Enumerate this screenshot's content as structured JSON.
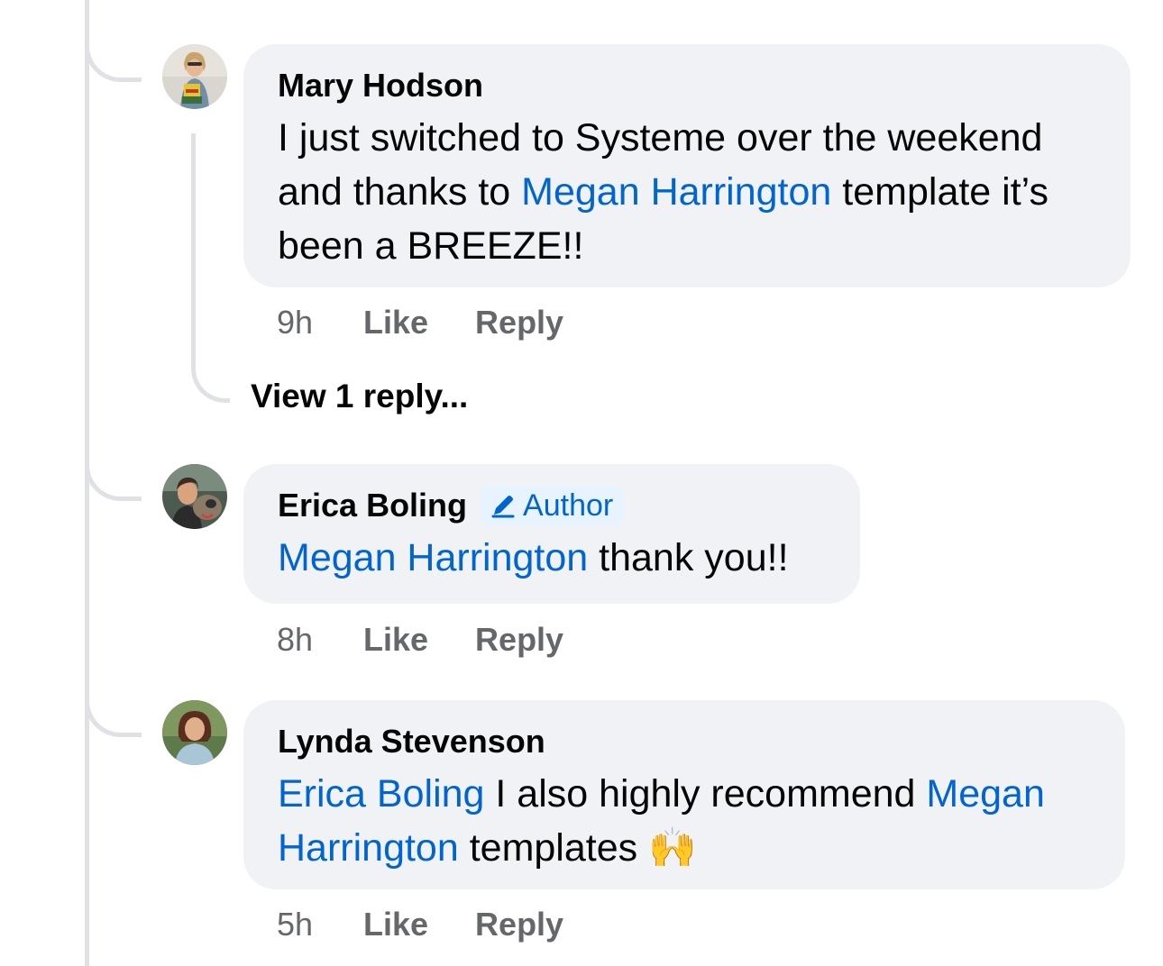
{
  "comments": [
    {
      "author": "Mary Hodson",
      "text_parts": [
        {
          "text": "I just switched to Systeme over the weekend and thanks to ",
          "mention": false
        },
        {
          "text": "Megan Harrington",
          "mention": true
        },
        {
          "text": " template it’s been a BREEZE!!",
          "mention": false
        }
      ],
      "time": "9h",
      "like": "Like",
      "reply": "Reply",
      "view_replies": "View 1 reply..."
    },
    {
      "author": "Erica Boling",
      "badge": "Author",
      "badge_icon": "pencil-icon",
      "text_parts": [
        {
          "text": "Megan Harrington",
          "mention": true
        },
        {
          "text": " thank you!!",
          "mention": false
        }
      ],
      "time": "8h",
      "like": "Like",
      "reply": "Reply"
    },
    {
      "author": "Lynda Stevenson",
      "text_parts": [
        {
          "text": "Erica Boling",
          "mention": true
        },
        {
          "text": " I also highly recommend ",
          "mention": false
        },
        {
          "text": "Megan Harrington",
          "mention": true
        },
        {
          "text": " templates ",
          "mention": false
        },
        {
          "text": "🙌",
          "mention": false
        }
      ],
      "time": "5h",
      "like": "Like",
      "reply": "Reply"
    }
  ],
  "colors": {
    "bubble": "#f0f2f5",
    "mention": "#0064d1",
    "meta": "#65676b",
    "thread_line": "#dfe1e5",
    "badge_bg": "#e7f3ff"
  }
}
